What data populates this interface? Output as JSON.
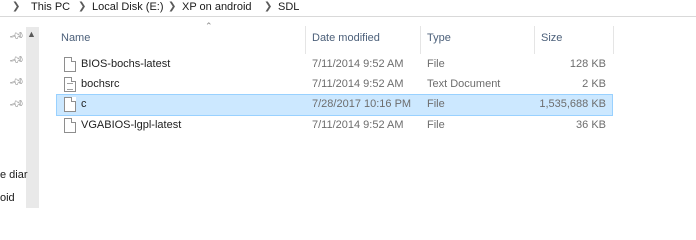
{
  "breadcrumb": {
    "items": [
      "This PC",
      "Local Disk (E:)",
      "XP on android",
      "SDL"
    ]
  },
  "nav": {
    "partial_items": [
      "e diar",
      "oid"
    ]
  },
  "columns": {
    "name": "Name",
    "date": "Date modified",
    "type": "Type",
    "size": "Size"
  },
  "files": [
    {
      "name": "BIOS-bochs-latest",
      "date": "7/11/2014 9:52 AM",
      "type": "File",
      "size": "128 KB",
      "icon": "file-icon"
    },
    {
      "name": "bochsrc",
      "date": "7/11/2014 9:52 AM",
      "type": "Text Document",
      "size": "2 KB",
      "icon": "text-document-icon"
    },
    {
      "name": "c",
      "date": "7/28/2017 10:16 PM",
      "type": "File",
      "size": "1,535,688 KB",
      "icon": "file-icon",
      "selected": true
    },
    {
      "name": "VGABIOS-lgpl-latest",
      "date": "7/11/2014 9:52 AM",
      "type": "File",
      "size": "36 KB",
      "icon": "file-icon"
    }
  ],
  "colors": {
    "selection": "#cce8ff",
    "selection_border": "#99d1ff",
    "header_text": "#4c607a"
  }
}
